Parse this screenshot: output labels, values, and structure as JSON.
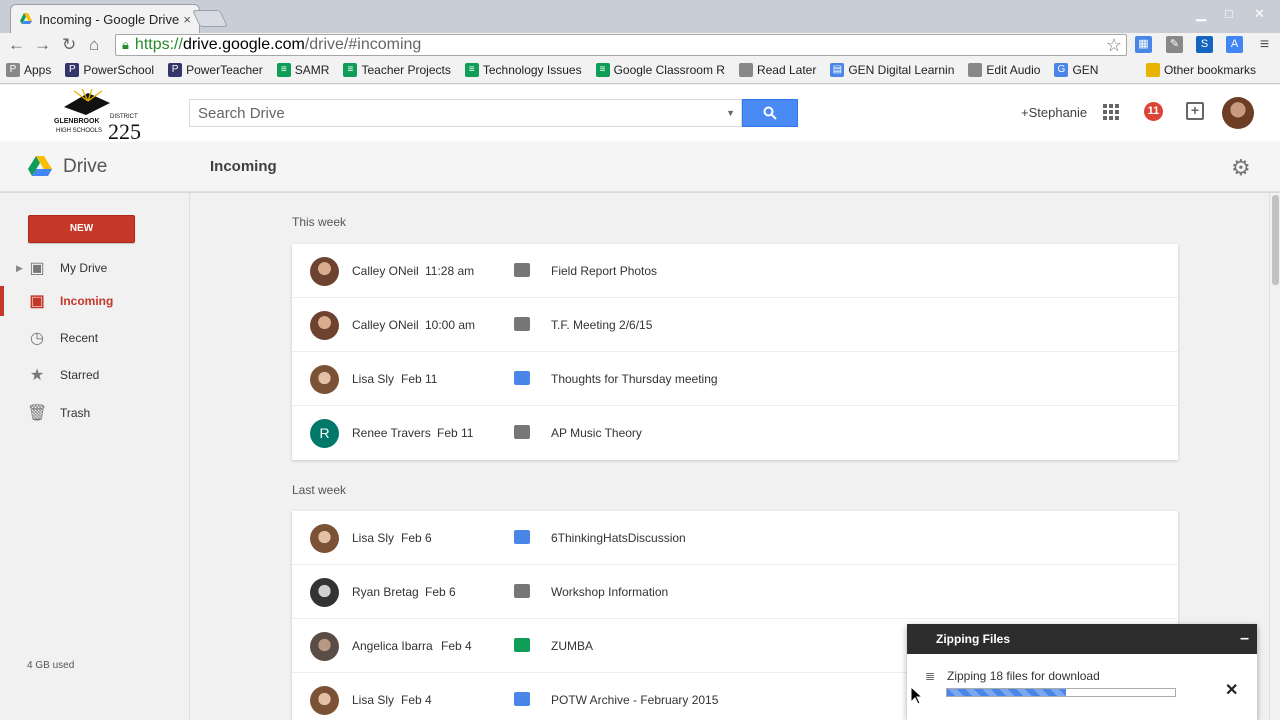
{
  "browser": {
    "tab_title": "Incoming - Google Drive",
    "tab_close": "×",
    "url_https": "https://",
    "url_host": "drive.google.com",
    "url_path": "/drive/#incoming",
    "bookmarks": [
      {
        "label": "Apps",
        "icon_color": "#888888",
        "icon": "P"
      },
      {
        "label": "PowerSchool",
        "icon_color": "#33356b",
        "icon": "P"
      },
      {
        "label": "PowerTeacher",
        "icon_color": "#33356b",
        "icon": "P"
      },
      {
        "label": "SAMR",
        "icon_color": "#0f9d58",
        "icon": "≡"
      },
      {
        "label": "Teacher Projects",
        "icon_color": "#0f9d58",
        "icon": "≡"
      },
      {
        "label": "Technology Issues",
        "icon_color": "#0f9d58",
        "icon": "≡"
      },
      {
        "label": "Google Classroom R",
        "icon_color": "#0f9d58",
        "icon": "≡"
      },
      {
        "label": "Read Later",
        "icon_color": "#888888",
        "icon": ""
      },
      {
        "label": "GEN Digital Learnin",
        "icon_color": "#4a86e8",
        "icon": "▤"
      },
      {
        "label": "Edit Audio",
        "icon_color": "#888888",
        "icon": ""
      },
      {
        "label": "GEN",
        "icon_color": "#4a86e8",
        "icon": "G"
      }
    ],
    "other_bookmarks": "Other bookmarks"
  },
  "header": {
    "logo_line1": "GLENBROOK",
    "logo_line2": "HIGH SCHOOLS",
    "logo_district": "DISTRICT",
    "logo_number": "225",
    "search_placeholder": "Search Drive",
    "user": "+Stephanie",
    "notifications": "11"
  },
  "drivebar": {
    "app_name": "Drive",
    "page_title": "Incoming"
  },
  "sidebar": {
    "new_label": "NEW",
    "items": [
      {
        "label": "My Drive",
        "icon": "drive-folder-icon"
      },
      {
        "label": "Incoming",
        "icon": "incoming-icon"
      },
      {
        "label": "Recent",
        "icon": "clock-icon"
      },
      {
        "label": "Starred",
        "icon": "star-icon"
      },
      {
        "label": "Trash",
        "icon": "trash-icon"
      }
    ],
    "quota": "4 GB used"
  },
  "main": {
    "sections": [
      {
        "label": "This week",
        "rows": [
          {
            "who": "Calley ONeil",
            "when": "11:28 am",
            "type": "folder",
            "name": "Field Report Photos"
          },
          {
            "who": "Calley ONeil",
            "when": "10:00 am",
            "type": "folder",
            "name": "T.F. Meeting 2/6/15"
          },
          {
            "who": "Lisa Sly",
            "when": "Feb 11",
            "type": "doc",
            "name": "Thoughts for Thursday meeting"
          },
          {
            "who": "Renee Travers",
            "when": "Feb 11",
            "type": "folder",
            "name": "AP Music Theory",
            "initial": "R"
          }
        ]
      },
      {
        "label": "Last week",
        "rows": [
          {
            "who": "Lisa Sly",
            "when": "Feb 6",
            "type": "doc",
            "name": "6ThinkingHatsDiscussion"
          },
          {
            "who": "Ryan Bretag",
            "when": "Feb 6",
            "type": "folder",
            "name": "Workshop Information"
          },
          {
            "who": "Angelica Ibarra",
            "when": "Feb 4",
            "type": "sheet",
            "name": "ZUMBA"
          },
          {
            "who": "Lisa Sly",
            "when": "Feb 4",
            "type": "doc",
            "name": "POTW Archive - February 2015"
          }
        ]
      }
    ]
  },
  "zip": {
    "title": "Zipping Files",
    "minimize": "–",
    "message": "Zipping 18 files for download",
    "progress": 0.52,
    "close": "✕"
  }
}
